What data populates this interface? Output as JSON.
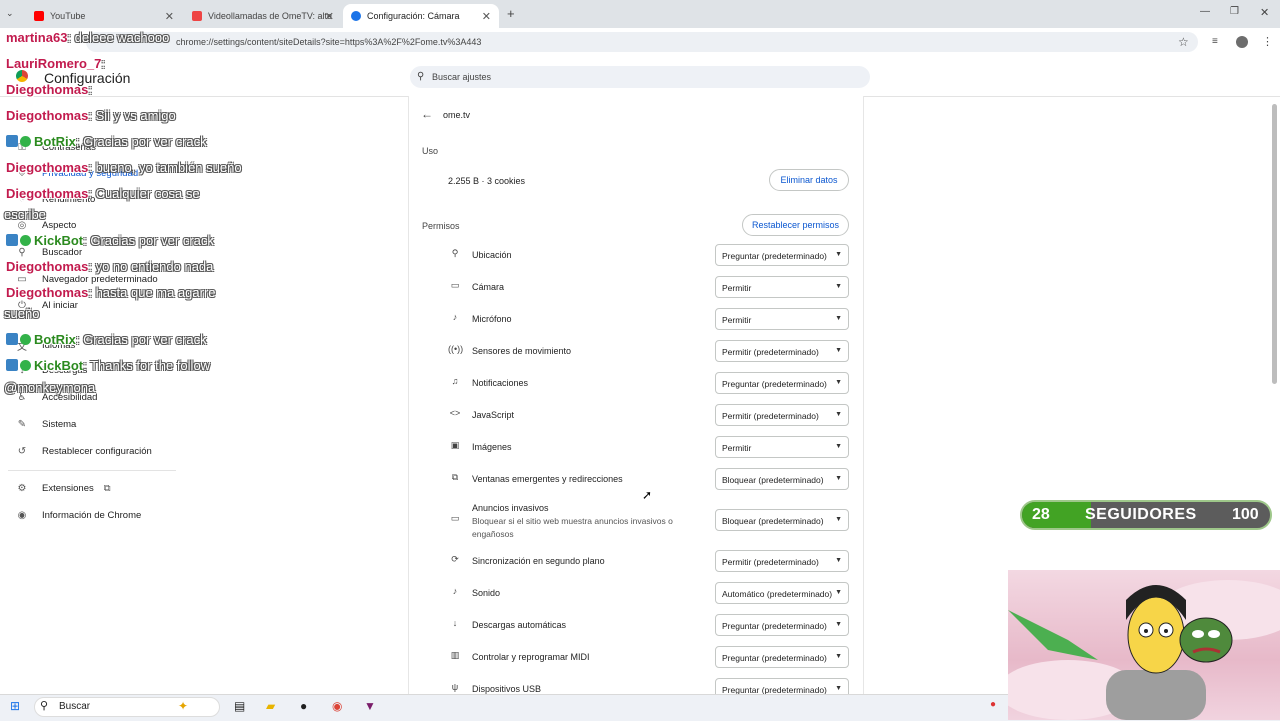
{
  "tabs": [
    {
      "label": "YouTube",
      "color": "#ff0000"
    },
    {
      "label": "Videollamadas de OmeTV: alte",
      "color": "#e44"
    },
    {
      "label": "Configuración: Cámara",
      "color": "#1a73e8"
    }
  ],
  "address_bar": {
    "url": "chrome://settings/content/siteDetails?site=https%3A%2F%2Fome.tv%3A443"
  },
  "settings": {
    "title": "Configuración",
    "search_placeholder": "Buscar ajustes",
    "nav": [
      {
        "label": "Contraseñas",
        "icon": "key-icon"
      },
      {
        "label": "Privacidad y seguridad",
        "icon": "shield-icon"
      },
      {
        "label": "Rendimiento",
        "icon": "gauge-icon"
      },
      {
        "label": "Aspecto",
        "icon": "palette-icon"
      },
      {
        "label": "Buscador",
        "icon": "search-icon"
      },
      {
        "label": "Navegador predeterminado",
        "icon": "browser-icon"
      },
      {
        "label": "Al iniciar",
        "icon": "power-icon"
      },
      {
        "label": "Idiomas",
        "icon": "language-icon"
      },
      {
        "label": "Descargas",
        "icon": "download-icon"
      },
      {
        "label": "Accesibilidad",
        "icon": "accessibility-icon"
      },
      {
        "label": "Sistema",
        "icon": "wrench-icon"
      },
      {
        "label": "Restablecer configuración",
        "icon": "reset-icon"
      },
      {
        "label": "Extensiones",
        "icon": "puzzle-icon"
      },
      {
        "label": "Información de Chrome",
        "icon": "chrome-icon"
      }
    ]
  },
  "site": {
    "name": "ome.tv",
    "usage_heading": "Uso",
    "usage_value": "2.255 B · 3 cookies",
    "clear_button": "Eliminar datos",
    "permissions_heading": "Permisos",
    "reset_button": "Restablecer permisos",
    "permissions": [
      {
        "label": "Ubicación",
        "value": "Preguntar (predeterminado)",
        "icon": "location-icon",
        "glyph": "⚲"
      },
      {
        "label": "Cámara",
        "value": "Permitir",
        "icon": "camera-icon",
        "glyph": "▭"
      },
      {
        "label": "Micrófono",
        "value": "Permitir",
        "icon": "microphone-icon",
        "glyph": "♪"
      },
      {
        "label": "Sensores de movimiento",
        "value": "Permitir (predeterminado)",
        "icon": "sensors-icon",
        "glyph": "((•))"
      },
      {
        "label": "Notificaciones",
        "value": "Preguntar (predeterminado)",
        "icon": "bell-icon",
        "glyph": "♫"
      },
      {
        "label": "JavaScript",
        "value": "Permitir (predeterminado)",
        "icon": "code-icon",
        "glyph": "<>"
      },
      {
        "label": "Imágenes",
        "value": "Permitir",
        "icon": "image-icon",
        "glyph": "▣"
      },
      {
        "label": "Ventanas emergentes y redirecciones",
        "value": "Bloquear (predeterminado)",
        "icon": "popup-icon",
        "glyph": "⧉"
      },
      {
        "label": "Anuncios invasivos",
        "value": "Bloquear (predeterminado)",
        "icon": "ads-icon",
        "glyph": "▭",
        "description": "Bloquear si el sitio web muestra anuncios invasivos o engañosos"
      },
      {
        "label": "Sincronización en segundo plano",
        "value": "Permitir (predeterminado)",
        "icon": "sync-icon",
        "glyph": "⟳"
      },
      {
        "label": "Sonido",
        "value": "Automático (predeterminado)",
        "icon": "volume-icon",
        "glyph": "♪"
      },
      {
        "label": "Descargas automáticas",
        "value": "Preguntar (predeterminado)",
        "icon": "download-icon",
        "glyph": "↓"
      },
      {
        "label": "Controlar y reprogramar MIDI",
        "value": "Preguntar (predeterminado)",
        "icon": "midi-icon",
        "glyph": "▥"
      },
      {
        "label": "Dispositivos USB",
        "value": "Preguntar (predeterminado)",
        "icon": "usb-icon",
        "glyph": "ψ"
      }
    ]
  },
  "chat": [
    {
      "user": "martina63",
      "text": ": deleee wachooo",
      "kind": "user"
    },
    {
      "user": "LauriRomero_7",
      "text": ": ",
      "kind": "user"
    },
    {
      "user": "Diegothomas",
      "text": ": ",
      "kind": "user"
    },
    {
      "user": "Diegothomas",
      "text": ": Sii y vs amigo",
      "kind": "user"
    },
    {
      "user": "BotRix",
      "text": ": Gracias por ver crack",
      "kind": "bot"
    },
    {
      "user": "Diegothomas",
      "text": ": bueno, yo también sueño",
      "kind": "user"
    },
    {
      "user": "Diegothomas",
      "text": ": Cualquier cosa se",
      "kind": "user",
      "cont": "escribe"
    },
    {
      "user": "KickBot",
      "text": ": Gracias por ver crack",
      "kind": "bot"
    },
    {
      "user": "Diegothomas",
      "text": ": yo no entiendo nada",
      "kind": "user"
    },
    {
      "user": "Diegothomas",
      "text": ": hasta que ma agarre",
      "kind": "user",
      "cont": "sueño"
    },
    {
      "user": "BotRix",
      "text": ": Gracias por ver crack",
      "kind": "bot"
    },
    {
      "user": "KickBot",
      "text": ": Thanks for the follow",
      "kind": "bot",
      "cont": "@monkeymona"
    }
  ],
  "followers": {
    "current": "28",
    "label": "SEGUIDORES",
    "goal": "100",
    "progress": 0.28
  },
  "taskbar": {
    "search_label": "Buscar"
  }
}
